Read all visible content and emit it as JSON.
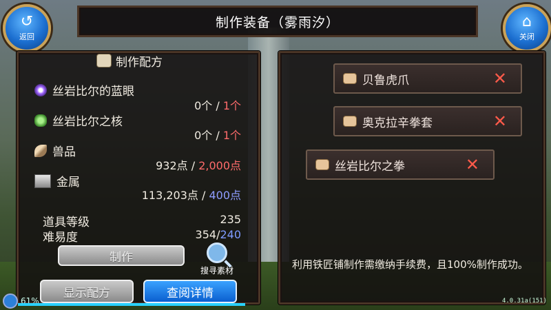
{
  "title": "制作装备（雾雨汐）",
  "nav": {
    "back_label": "返回",
    "close_label": "关闭"
  },
  "recipe": {
    "heading": "制作配方",
    "materials": [
      {
        "name": "丝岩比尔的蓝眼",
        "have": "0个",
        "need": "1个",
        "need_color": "red",
        "icon": "eye-orb-icon"
      },
      {
        "name": "丝岩比尔之核",
        "have": "0个",
        "need": "1个",
        "need_color": "red",
        "icon": "leaf-core-icon"
      },
      {
        "name": "兽品",
        "have": "932点",
        "need": "2,000点",
        "need_color": "red",
        "icon": "claw-icon"
      },
      {
        "name": "金属",
        "have": "113,203点",
        "need": "400点",
        "need_color": "blue",
        "icon": "metal-ingot-icon"
      }
    ],
    "item_level_label": "道具等级",
    "item_level_value": "235",
    "difficulty_label": "难易度",
    "difficulty_current": "354",
    "difficulty_max": "240",
    "separator": " / ",
    "craft_button": "制作",
    "search_label": "搜寻素材",
    "show_recipe_button": "显示配方",
    "view_details_button": "查阅详情"
  },
  "equipment_list": [
    {
      "name": "贝鲁虎爪"
    },
    {
      "name": "奥克拉辛拳套"
    },
    {
      "name": "丝岩比尔之拳"
    }
  ],
  "description": "利用铁匠铺制作需缴纳手续费，且100%制作成功。",
  "status": {
    "battery": "61%",
    "version": "4.0.31a(151)"
  },
  "colors": {
    "need_red": "#ff6b6b",
    "need_blue": "#8f9dff",
    "remove_x": "#ff5a4a",
    "blue_button": "#0a5fcf"
  }
}
